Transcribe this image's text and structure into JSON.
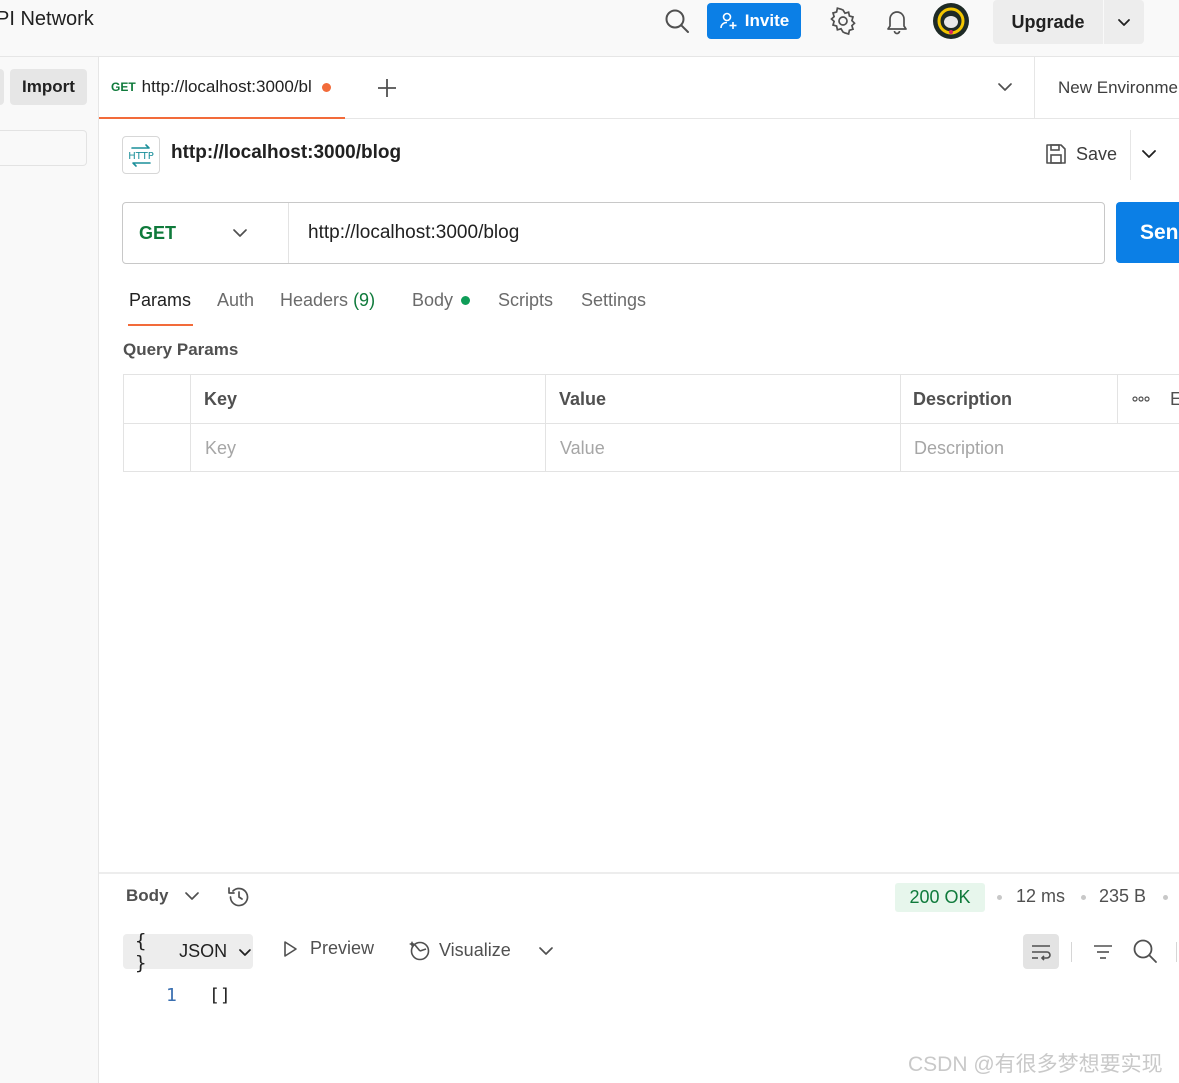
{
  "app": {
    "workspace_title": "PI Network",
    "invite_label": "Invite",
    "upgrade_label": "Upgrade"
  },
  "sidebar": {
    "import_label": "Import"
  },
  "tabs": {
    "active": {
      "method": "GET",
      "title": "http://localhost:3000/bl"
    },
    "environment_label": "New Environme"
  },
  "request": {
    "name": "http://localhost:3000/blog",
    "save_label": "Save",
    "method": "GET",
    "url": "http://localhost:3000/blog",
    "send_label": "Sen",
    "subtabs": {
      "params": "Params",
      "auth": "Auth",
      "headers": "Headers",
      "headers_count": "(9)",
      "body": "Body",
      "scripts": "Scripts",
      "settings": "Settings"
    },
    "query_params_label": "Query Params",
    "params_table": {
      "headers": [
        "Key",
        "Value",
        "Description"
      ],
      "placeholders": [
        "Key",
        "Value",
        "Description"
      ],
      "bulk_edit_label": "E"
    }
  },
  "response": {
    "body_tab_label": "Body",
    "status": "200 OK",
    "time": "12 ms",
    "size": "235 B",
    "format_label": "JSON",
    "format_brace": "{ }",
    "preview_label": "Preview",
    "visualize_label": "Visualize",
    "lines": [
      {
        "number": "1",
        "text": "[]"
      }
    ]
  },
  "watermark": "CSDN @有很多梦想要实现",
  "colors": {
    "accent": "#0b7fe6",
    "tab_indicator": "#f26b3a",
    "get_method": "#0f7a3b",
    "status_ok_bg": "#e7f6ec"
  }
}
